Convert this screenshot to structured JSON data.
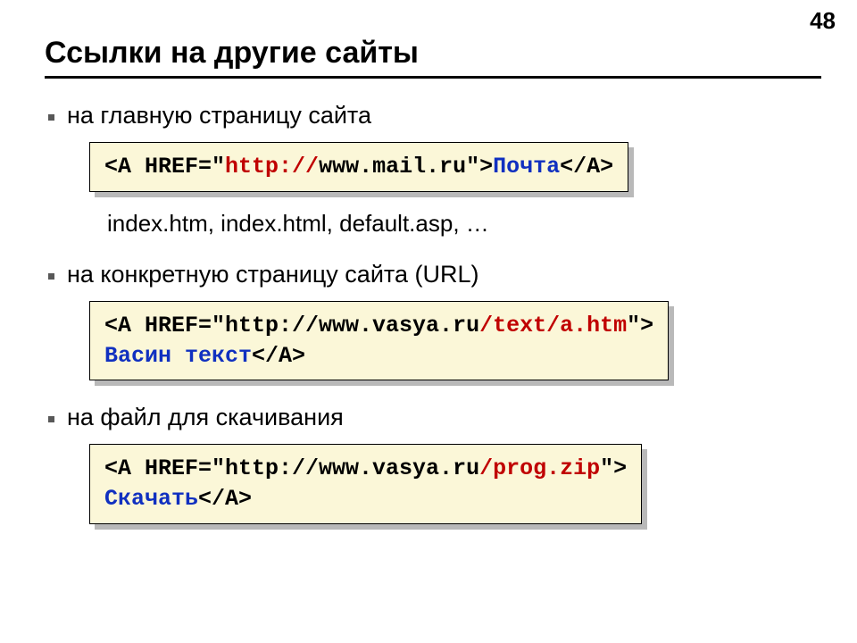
{
  "page_number": "48",
  "title": "Ссылки на другие сайты",
  "bullet1": "на главную страницу сайта",
  "code1": {
    "p1": "<A HREF=\"",
    "p2": "http://",
    "p3": "www.mail.ru\">",
    "p4": "Почта",
    "p5": "</A>"
  },
  "sub1": "index.htm, index.html, default.asp, …",
  "bullet2": "на конкретную страницу сайта (URL)",
  "code2": {
    "p1": "<A HREF=\"http://www.vasya.ru",
    "p2": "/text/a.htm",
    "p3": "\">",
    "p4": "Васин текст",
    "p5": "</A>"
  },
  "bullet3": "на файл для скачивания",
  "code3": {
    "p1": "<A HREF=\"http://www.vasya.ru",
    "p2": "/prog.zip",
    "p3": "\">",
    "p4": "Скачать",
    "p5": "</A>"
  }
}
